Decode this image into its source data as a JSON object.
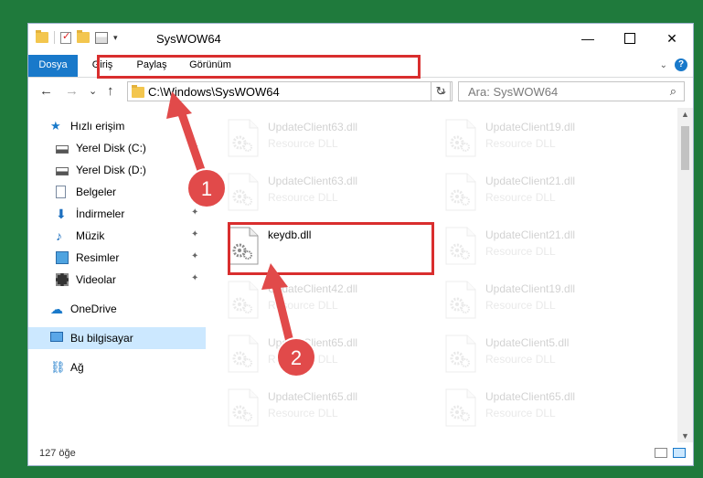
{
  "window": {
    "title": "SysWOW64",
    "controls": {
      "minimize": "—",
      "maximize": "",
      "close": "✕"
    }
  },
  "ribbon": {
    "tabs": [
      "Dosya",
      "Giriş",
      "Paylaş",
      "Görünüm"
    ],
    "active_tab": "Dosya"
  },
  "navbar": {
    "back": "←",
    "forward": "→",
    "recent": "⌄",
    "up": "↑",
    "address": "C:\\Windows\\SysWOW64",
    "search_placeholder": "Ara: SysWOW64"
  },
  "nav_pane": {
    "items": [
      {
        "label": "Hızlı erişim",
        "icon": "star-icon"
      },
      {
        "label": "Yerel Disk (C:)",
        "icon": "drive-icon"
      },
      {
        "label": "Yerel Disk (D:)",
        "icon": "drive-icon"
      },
      {
        "label": "Belgeler",
        "icon": "document-icon"
      },
      {
        "label": "İndirmeler",
        "icon": "download-icon",
        "pinned": true
      },
      {
        "label": "Müzik",
        "icon": "music-icon",
        "pinned": true
      },
      {
        "label": "Resimler",
        "icon": "pictures-icon",
        "pinned": true
      },
      {
        "label": "Videolar",
        "icon": "video-icon",
        "pinned": true
      },
      {
        "label": "OneDrive",
        "icon": "cloud-icon"
      },
      {
        "label": "Bu bilgisayar",
        "icon": "computer-icon",
        "selected": true
      },
      {
        "label": "Ağ",
        "icon": "network-icon"
      }
    ]
  },
  "files": [
    {
      "name": "UpdateClient63.dll",
      "type": "Resource DLL"
    },
    {
      "name": "UpdateClient19.dll",
      "type": "Resource DLL"
    },
    {
      "name": "UpdateClient63.dll",
      "type": "Resource DLL"
    },
    {
      "name": "UpdateClient21.dll",
      "type": "Resource DLL"
    },
    {
      "name": "keydb.dll",
      "type": "",
      "highlighted": true
    },
    {
      "name": "UpdateClient21.dll",
      "type": "Resource DLL"
    },
    {
      "name": "UpdateClient42.dll",
      "type": "Resource DLL"
    },
    {
      "name": "UpdateClient19.dll",
      "type": "Resource DLL"
    },
    {
      "name": "UpdateClient65.dll",
      "type": "Resource DLL"
    },
    {
      "name": "UpdateClient5.dll",
      "type": "Resource DLL"
    },
    {
      "name": "UpdateClient65.dll",
      "type": "Resource DLL"
    },
    {
      "name": "UpdateClient65.dll",
      "type": "Resource DLL"
    }
  ],
  "status": {
    "item_count": "127 öğe"
  },
  "annotations": {
    "step1": "1",
    "step2": "2"
  },
  "colors": {
    "accent": "#1979ca",
    "highlight": "#d92e2e",
    "selection": "#cce8ff"
  }
}
